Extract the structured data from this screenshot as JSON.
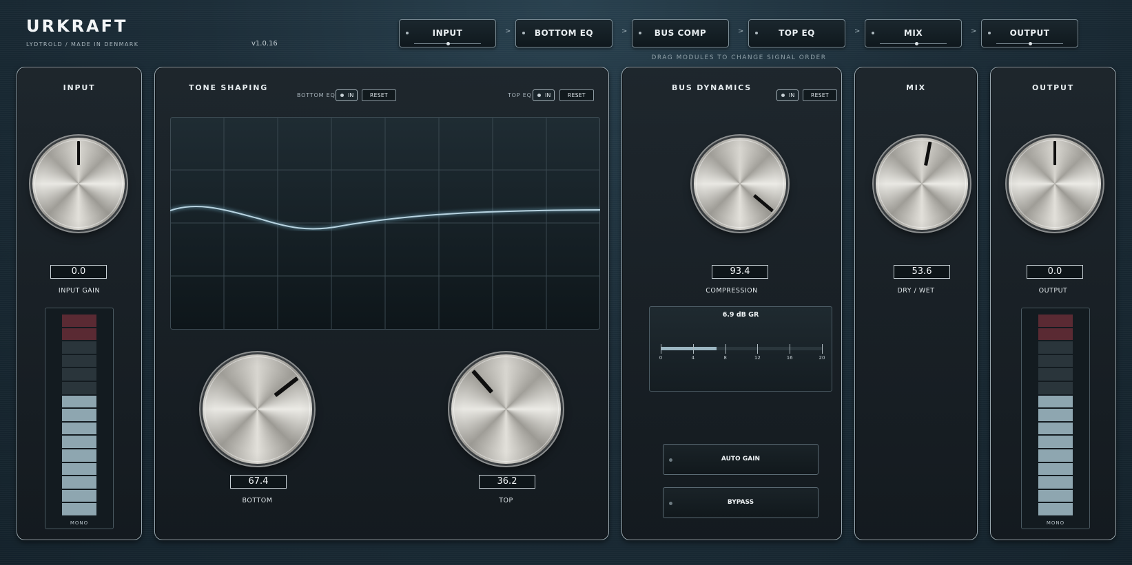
{
  "header": {
    "brand": "URKRAFT",
    "tagline": "LYDTROLD / MADE IN DENMARK",
    "version": "v1.0.16",
    "drag_hint": "DRAG MODULES TO CHANGE SIGNAL ORDER"
  },
  "signal_chain": {
    "arrow": ">",
    "modules": [
      {
        "label": "INPUT",
        "has_slider": true,
        "slider_value": 0.5
      },
      {
        "label": "BOTTOM EQ",
        "has_slider": false
      },
      {
        "label": "BUS COMP",
        "has_slider": false
      },
      {
        "label": "TOP EQ",
        "has_slider": false
      },
      {
        "label": "MIX",
        "has_slider": true,
        "slider_value": 0.54
      },
      {
        "label": "OUTPUT",
        "has_slider": true,
        "slider_value": 0.5
      }
    ]
  },
  "input": {
    "title": "INPUT",
    "value": "0.0",
    "caption": "INPUT GAIN",
    "knob_value": 0.5,
    "meter_label": "MONO",
    "meter": {
      "segments": 15,
      "lit": 9,
      "peak_segments": 2
    }
  },
  "tone": {
    "title": "TONE SHAPING",
    "bottom_eq_label": "BOTTOM EQ",
    "top_eq_label": "TOP EQ",
    "in_label": "IN",
    "reset_label": "RESET",
    "curve_color": "#b8d3e0",
    "bottom": {
      "value": "67.4",
      "caption": "BOTTOM",
      "knob_value": 0.674
    },
    "top": {
      "value": "36.2",
      "caption": "TOP",
      "knob_value": 0.362
    }
  },
  "dynamics": {
    "title": "BUS DYNAMICS",
    "in_label": "IN",
    "reset_label": "RESET",
    "value": "93.4",
    "caption": "COMPRESSION",
    "knob_value": 0.934,
    "gr": {
      "label": "6.9 dB GR",
      "value": 6.9,
      "max": 20,
      "ticks": [
        "0",
        "4",
        "8",
        "12",
        "16",
        "20"
      ]
    },
    "auto_gain_label": "AUTO GAIN",
    "bypass_label": "BYPASS"
  },
  "mix": {
    "title": "MIX",
    "value": "53.6",
    "caption": "DRY / WET",
    "knob_value": 0.536
  },
  "output": {
    "title": "OUTPUT",
    "value": "0.0",
    "caption": "OUTPUT",
    "knob_value": 0.5,
    "meter_label": "MONO",
    "meter": {
      "segments": 15,
      "lit": 9,
      "peak_segments": 2
    }
  },
  "colors": {
    "accent": "#8fb0bd",
    "meter_lit": "#8ea6b0",
    "meter_peak": "#5a2a33",
    "meter_off": "#2a353b"
  }
}
